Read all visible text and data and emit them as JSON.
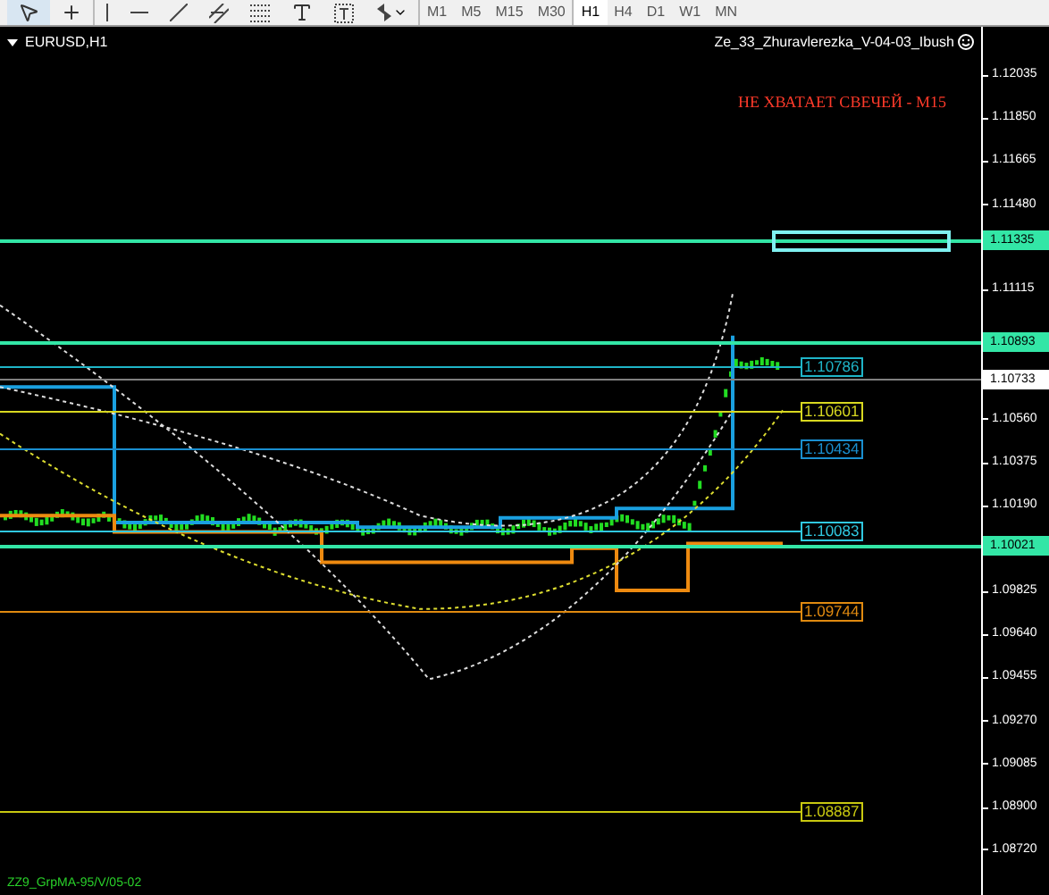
{
  "toolbar": {
    "tools": [
      {
        "kind": "cursor",
        "selected": true
      },
      {
        "kind": "crosshair",
        "selected": false
      },
      {
        "kind": "vline",
        "selected": false
      },
      {
        "kind": "hline",
        "selected": false
      },
      {
        "kind": "trend",
        "selected": false
      },
      {
        "kind": "channel",
        "selected": false
      },
      {
        "kind": "fibo",
        "selected": false
      },
      {
        "kind": "text",
        "selected": false
      },
      {
        "kind": "label",
        "selected": false
      },
      {
        "kind": "arrows",
        "selected": false
      }
    ],
    "timeframes": [
      {
        "label": "M1",
        "selected": false
      },
      {
        "label": "M5",
        "selected": false
      },
      {
        "label": "M15",
        "selected": false
      },
      {
        "label": "M30",
        "selected": false
      },
      {
        "label": "H1",
        "selected": true
      },
      {
        "label": "H4",
        "selected": false
      },
      {
        "label": "D1",
        "selected": false
      },
      {
        "label": "W1",
        "selected": false
      },
      {
        "label": "MN",
        "selected": false
      }
    ]
  },
  "chart": {
    "symbol": "EURUSD,H1",
    "indicator": "Ze_33_Zhuravlerezka_V-04-03_Ibush",
    "warning": "НЕ ХВАТАЕТ СВЕЧЕЙ - M15",
    "footer": "ZZ9_GrpMA-95/V/05-02",
    "axis_ticks": [
      "1.12035",
      "1.11850",
      "1.11665",
      "1.11480",
      "1.11115",
      "1.10560",
      "1.10375",
      "1.10190",
      "1.09825",
      "1.09640",
      "1.09455",
      "1.09270",
      "1.09085",
      "1.08900",
      "1.08720"
    ],
    "axis_lines": [
      {
        "price": "1.11335",
        "kind": "level",
        "color": "#33e6a6"
      },
      {
        "price": "1.10893",
        "kind": "level",
        "color": "#33e6a6"
      },
      {
        "price": "1.10733",
        "kind": "current",
        "color": "#808080"
      },
      {
        "price": "1.10021",
        "kind": "level",
        "color": "#33e6a6"
      }
    ],
    "price_lines": [
      {
        "price": "1.10786",
        "color": "#1fb5c8"
      },
      {
        "price": "1.10601",
        "color": "#d8d820"
      },
      {
        "price": "1.10434",
        "color": "#1a8fd0"
      },
      {
        "price": "1.10083",
        "color": "#30c8e0"
      },
      {
        "price": "1.09744",
        "color": "#e08a10"
      },
      {
        "price": "1.08887",
        "color": "#c8c810"
      }
    ]
  }
}
